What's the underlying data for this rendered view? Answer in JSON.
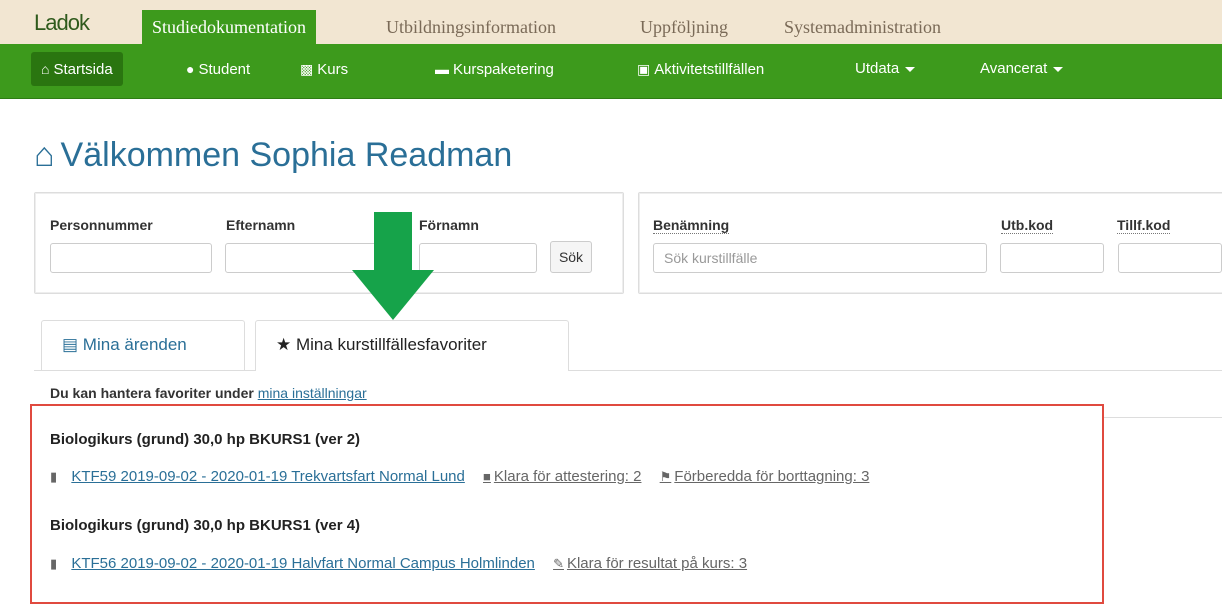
{
  "header": {
    "logo": "Ladok",
    "tabs": [
      {
        "label": "Studiedokumentation",
        "active": true
      },
      {
        "label": "Utbildningsinformation",
        "active": false
      },
      {
        "label": "Uppföljning",
        "active": false
      },
      {
        "label": "Systemadministration",
        "active": false
      }
    ]
  },
  "nav": {
    "items": [
      {
        "label": "Startsida",
        "icon": "home-icon"
      },
      {
        "label": "Student",
        "icon": "user-icon"
      },
      {
        "label": "Kurs",
        "icon": "book-icon"
      },
      {
        "label": "Kurspaketering",
        "icon": "folder-icon"
      },
      {
        "label": "Aktivitetstillfällen",
        "icon": "calendar-icon"
      },
      {
        "label": "Utdata",
        "icon": "caret-down-icon"
      },
      {
        "label": "Avancerat",
        "icon": "caret-down-icon"
      }
    ]
  },
  "welcome": {
    "text": "Välkommen Sophia Readman"
  },
  "student_search": {
    "personnummer_label": "Personnummer",
    "efternamn_label": "Efternamn",
    "fornamn_label": "Förnamn",
    "button_label": "Sök"
  },
  "course_search": {
    "benamning_label": "Benämning",
    "placeholder": "Sök kurstillfälle",
    "utbkod_label": "Utb.kod",
    "tillfkod_label": "Tillf.kod"
  },
  "tabs": {
    "inactive": "Mina ärenden",
    "active": "Mina kurstillfällesfavoriter"
  },
  "hint": {
    "text": "Du kan hantera favoriter under",
    "link": "mina inställningar"
  },
  "favorites": [
    {
      "course": "Biologikurs (grund) 30,0 hp BKURS1 (ver 2)",
      "occasion": "KTF59 2019-09-02 - 2020-01-19 Trekvartsfart Normal Lund",
      "meta1": "Klara för attestering: 2",
      "meta2": "Förberedda för borttagning: 3"
    },
    {
      "course": "Biologikurs (grund) 30,0 hp BKURS1 (ver 4)",
      "occasion": "KTF56 2019-09-02 - 2020-01-19 Halvfart Normal Campus Holmlinden",
      "meta1": "Klara för resultat på kurs: 3"
    }
  ],
  "colors": {
    "nav_green": "#3d9a1c",
    "link_blue": "#2a6f97",
    "highlight_red": "#e04a3f",
    "arrow_green": "#16a34a"
  }
}
